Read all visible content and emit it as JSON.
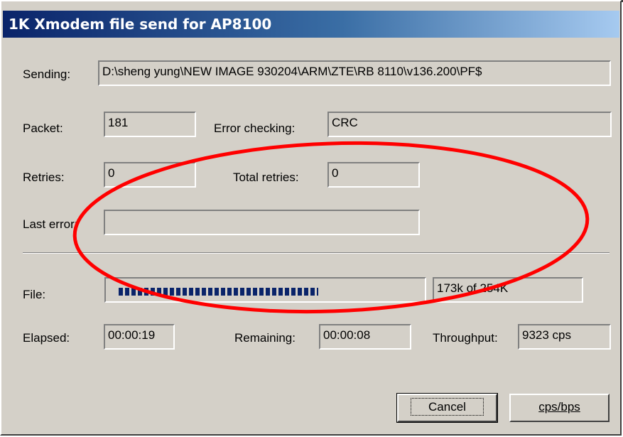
{
  "window": {
    "title": "1K Xmodem file send for AP8100"
  },
  "sending": {
    "label": "Sending:",
    "value": "D:\\sheng yung\\NEW IMAGE 930204\\ARM\\ZTE\\RB 8110\\v136.200\\PF$"
  },
  "packet": {
    "label": "Packet:",
    "value": "181"
  },
  "error_checking": {
    "label": "Error checking:",
    "value": "CRC"
  },
  "retries": {
    "label": "Retries:",
    "value": "0"
  },
  "total_retries": {
    "label": "Total retries:",
    "value": "0"
  },
  "last_error": {
    "label": "Last error:",
    "value": ""
  },
  "file": {
    "label": "File:",
    "progress_fraction": 0.68,
    "size_text": "173k of 254K"
  },
  "elapsed": {
    "label": "Elapsed:",
    "value": "00:00:19"
  },
  "remaining": {
    "label": "Remaining:",
    "value": "00:00:08"
  },
  "throughput": {
    "label": "Throughput:",
    "value": "9323 cps"
  },
  "buttons": {
    "cancel": "Cancel",
    "cps_bps": "cps/bps"
  },
  "colors": {
    "titlebar_start": "#0a246a",
    "titlebar_end": "#a6caf0",
    "annotation": "#ff0000",
    "dialog_bg": "#d4d0c8"
  }
}
